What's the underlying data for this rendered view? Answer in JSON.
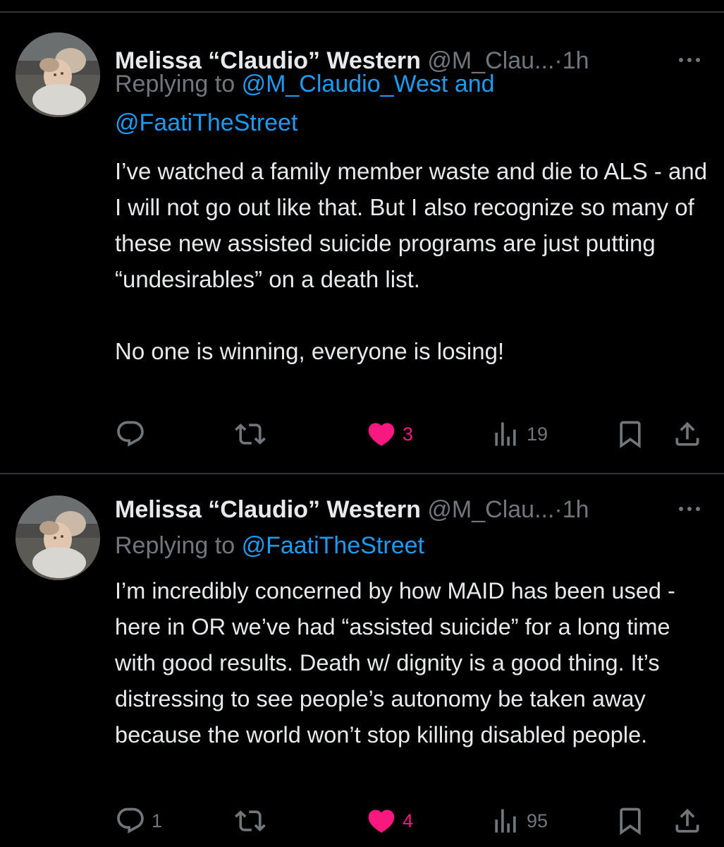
{
  "colors": {
    "background": "#000000",
    "text": "#e7e9ea",
    "muted": "#71767b",
    "link": "#1d9bf0",
    "like": "#f91880",
    "divider": "#2f3336"
  },
  "tweets": [
    {
      "display_name": "Melissa “Claudio” Western",
      "handle": "@M_Clau...",
      "separator": "·",
      "time": "1h",
      "more_icon": "more-horizontal-icon",
      "replying_to_prefix": "Replying to",
      "mentions": [
        "@M_Claudio_West",
        "@FaatiTheStreet"
      ],
      "mention_joiner": "and",
      "paragraphs": [
        "I’ve watched a family member waste and die to ALS - and I will not go out like that. But I also recognize so many of these new assisted suicide programs are just putting “undesirables” on a death list.",
        "No one is winning, everyone is losing!"
      ],
      "actions": {
        "reply_count": "",
        "retweet_count": "",
        "like_count": "3",
        "liked": true,
        "view_count": "19"
      }
    },
    {
      "display_name": "Melissa “Claudio” Western",
      "handle": "@M_Clau...",
      "separator": "·",
      "time": "1h",
      "more_icon": "more-horizontal-icon",
      "replying_to_prefix": "Replying to",
      "mentions": [
        "@FaatiTheStreet"
      ],
      "paragraphs": [
        "I’m incredibly concerned by how MAID has been used - here in OR we’ve had “assisted suicide” for a long time with good results. Death w/ dignity is a good thing. It’s distressing to see people’s autonomy be taken away because the world won’t stop killing disabled people."
      ],
      "actions": {
        "reply_count": "1",
        "retweet_count": "",
        "like_count": "4",
        "liked": true,
        "view_count": "95"
      }
    }
  ]
}
